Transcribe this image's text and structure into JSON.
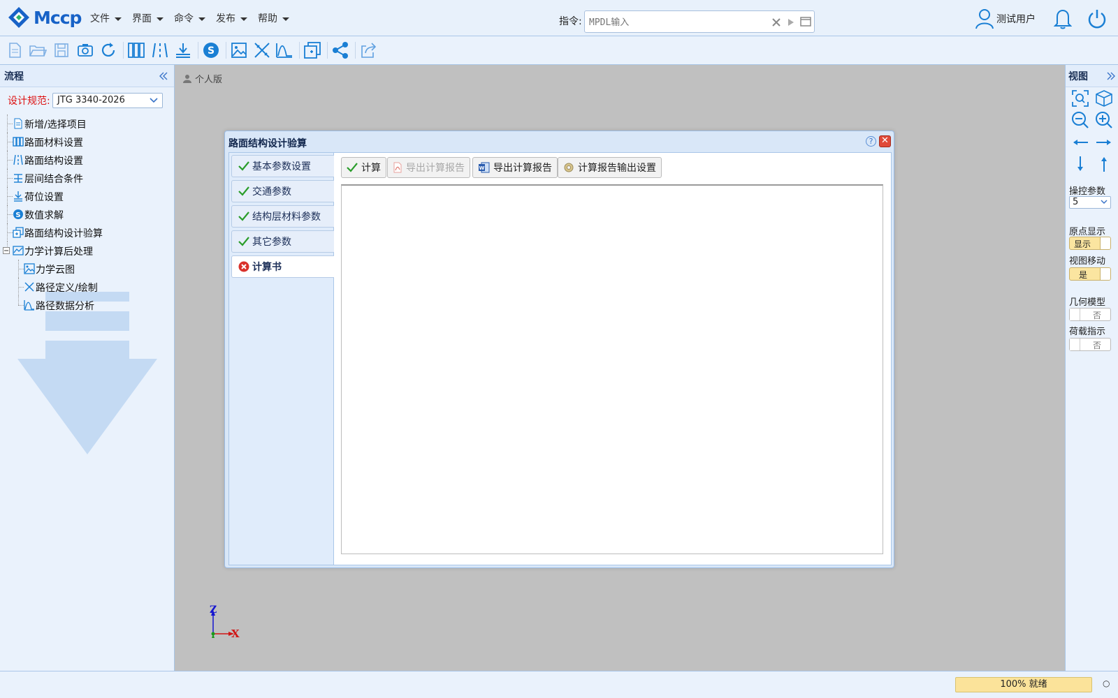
{
  "app": {
    "logo_text": "Mccp"
  },
  "menu": [
    {
      "label": "文件"
    },
    {
      "label": "界面"
    },
    {
      "label": "命令"
    },
    {
      "label": "发布"
    },
    {
      "label": "帮助"
    }
  ],
  "command": {
    "label": "指令:",
    "placeholder": "MPDL输入"
  },
  "user": {
    "name": "测试用户"
  },
  "toolbar": {
    "icons": [
      "new-file-icon",
      "open-folder-icon",
      "save-icon",
      "snapshot-icon",
      "refresh-icon",
      "material-icon",
      "structure-icon",
      "interlayer-icon",
      "solve-icon",
      "cloud-image-icon",
      "path-icon",
      "analysis-icon",
      "verify-icon",
      "share-icon",
      "export-icon"
    ]
  },
  "left_panel": {
    "title": "流程",
    "spec_label": "设计规范:",
    "spec_value": "JTG 3340-2026",
    "tree": [
      {
        "label": "新增/选择项目",
        "icon": "document-icon"
      },
      {
        "label": "路面材料设置",
        "icon": "material-icon"
      },
      {
        "label": "路面结构设置",
        "icon": "structure-icon"
      },
      {
        "label": "层间结合条件",
        "icon": "interlayer-icon"
      },
      {
        "label": "荷位设置",
        "icon": "load-position-icon"
      },
      {
        "label": "数值求解",
        "icon": "solve-icon"
      },
      {
        "label": "路面结构设计验算",
        "icon": "verify-icon"
      },
      {
        "label": "力学计算后处理",
        "icon": "postprocess-icon"
      },
      {
        "label": "力学云图",
        "icon": "cloud-image-icon"
      },
      {
        "label": "路径定义/绘制",
        "icon": "path-icon"
      },
      {
        "label": "路径数据分析",
        "icon": "analysis-icon"
      }
    ]
  },
  "canvas": {
    "edition": "个人版",
    "axis_z": "Z",
    "axis_x": "X"
  },
  "right_panel": {
    "title": "视图",
    "control_label": "操控参数",
    "control_value": "5",
    "origin_label": "原点显示",
    "origin_value": "显示",
    "move_label": "视图移动",
    "move_value": "是",
    "geometry_label": "几何模型",
    "geometry_value": "否",
    "load_label": "荷载指示",
    "load_value": "否"
  },
  "dialog": {
    "title": "路面结构设计验算",
    "help": "?",
    "close": "✕",
    "tabs": [
      {
        "label": "基本参数设置",
        "status": "ok"
      },
      {
        "label": "交通参数",
        "status": "ok"
      },
      {
        "label": "结构层材料参数",
        "status": "ok"
      },
      {
        "label": "其它参数",
        "status": "ok"
      },
      {
        "label": "计算书",
        "status": "error"
      }
    ],
    "buttons": {
      "calc": "计算",
      "export_pdf": "导出计算报告",
      "export_word": "导出计算报告",
      "report_settings": "计算报告输出设置"
    }
  },
  "status": {
    "progress_text": "100% 就绪",
    "indicator": "○"
  },
  "colors": {
    "accent": "#1a7fd4",
    "panel_bg": "#eaf2fc",
    "canvas_bg": "#c0c0c0",
    "ok_green": "#2a9d2a",
    "error_red": "#d9312b",
    "spec_red": "#dd1111"
  }
}
